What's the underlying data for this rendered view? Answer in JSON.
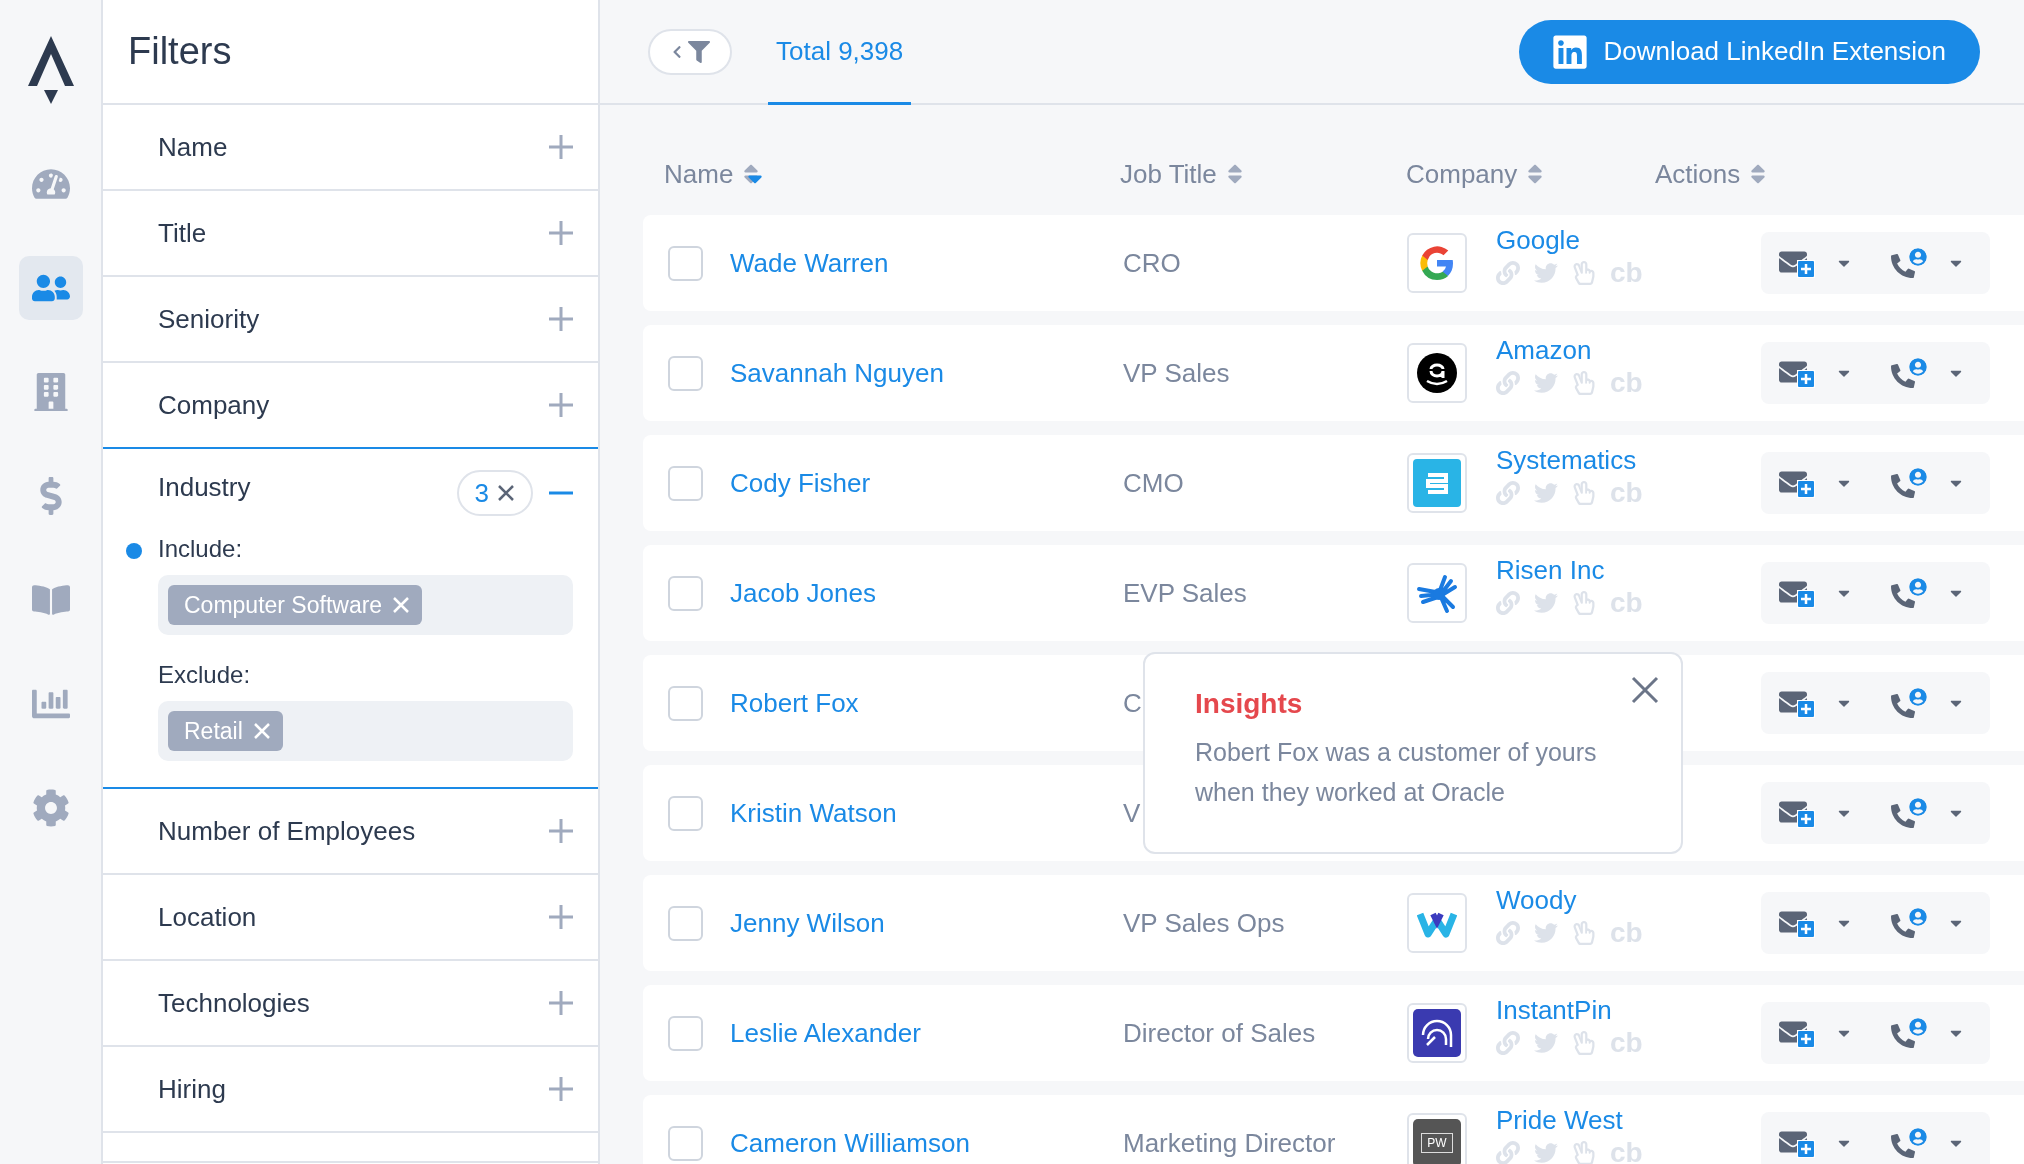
{
  "nav": [
    {
      "kind": "gauge",
      "selected": false
    },
    {
      "kind": "people",
      "selected": true
    },
    {
      "kind": "building",
      "selected": false
    },
    {
      "kind": "dollar",
      "selected": false
    },
    {
      "kind": "book",
      "selected": false
    },
    {
      "kind": "chart",
      "selected": false
    },
    {
      "kind": "gear",
      "selected": false
    }
  ],
  "filters": {
    "title": "Filters",
    "items": [
      {
        "label": "Name",
        "expanded": false
      },
      {
        "label": "Title",
        "expanded": false
      },
      {
        "label": "Seniority",
        "expanded": false
      },
      {
        "label": "Company",
        "expanded": false
      },
      {
        "label": "Industry",
        "expanded": true,
        "count": "3",
        "sections": [
          {
            "label": "Include:",
            "selected": true,
            "tags": [
              "Computer Software"
            ]
          },
          {
            "label": "Exclude:",
            "selected": false,
            "tags": [
              "Retail"
            ]
          }
        ]
      },
      {
        "label": "Number of Employees",
        "expanded": false
      },
      {
        "label": "Location",
        "expanded": false
      },
      {
        "label": "Technologies",
        "expanded": false
      },
      {
        "label": "Hiring",
        "expanded": false
      }
    ]
  },
  "toolbar": {
    "total_tab": "Total 9,398",
    "download_button": "Download LinkedIn Extension"
  },
  "table": {
    "columns": [
      {
        "label": "Name",
        "sorted": true
      },
      {
        "label": "Job Title",
        "sorted": false
      },
      {
        "label": "Company",
        "sorted": false
      },
      {
        "label": "Actions",
        "sorted": false
      }
    ],
    "rows": [
      {
        "name": "Wade Warren",
        "job_title": "CRO",
        "company": "Google",
        "kind": "google",
        "crunchbase": "cb",
        "checked": false
      },
      {
        "name": "Savannah Nguyen",
        "job_title": "VP Sales",
        "company": "Amazon",
        "kind": "amazon",
        "crunchbase": "cb",
        "checked": false
      },
      {
        "name": "Cody Fisher",
        "job_title": "CMO",
        "company": "Systematics",
        "kind": "systematics",
        "crunchbase": "cb",
        "checked": false
      },
      {
        "name": "Jacob Jones",
        "job_title": "EVP Sales",
        "company": "Risen Inc",
        "kind": "risen",
        "crunchbase": "cb",
        "checked": false
      },
      {
        "name": "Robert Fox",
        "job_title": "C",
        "checked": false
      },
      {
        "name": "Kristin Watson",
        "job_title": "V",
        "checked": false
      },
      {
        "name": "Jenny Wilson",
        "job_title": "VP Sales Ops",
        "company": "Woody",
        "kind": "woody",
        "crunchbase": "cb",
        "checked": false
      },
      {
        "name": "Leslie Alexander",
        "job_title": "Director of Sales",
        "company": "InstantPin",
        "kind": "instantpin",
        "crunchbase": "cb",
        "checked": false
      },
      {
        "name": "Cameron Williamson",
        "job_title": "Marketing Director",
        "company": "Pride West",
        "kind": "pridewest",
        "logo_text": "PW",
        "crunchbase": "cb",
        "checked": false
      }
    ]
  },
  "insight": {
    "title": "Insights",
    "text": "Robert Fox was a customer of yours when they worked at Oracle"
  }
}
